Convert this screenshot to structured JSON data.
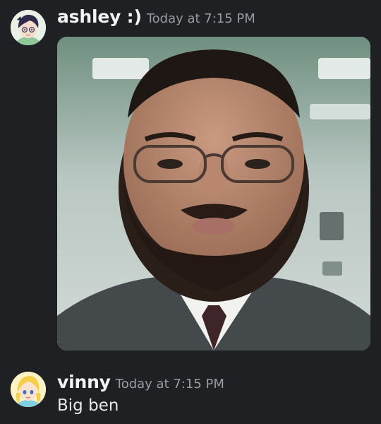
{
  "messages": [
    {
      "username": "ashley :)",
      "timestamp": "Today at 7:15 PM",
      "avatar": "anime-avatar-dark-hair",
      "attachment": "image-portrait-man-glasses-beard-office"
    },
    {
      "username": "vinny",
      "timestamp": "Today at 7:15 PM",
      "avatar": "anime-avatar-blonde",
      "text": "Big ben"
    }
  ],
  "colors": {
    "background": "#1f2023",
    "username": "#f2f3f5",
    "timestamp": "#9a9ca3",
    "text": "#e6e8ea"
  }
}
